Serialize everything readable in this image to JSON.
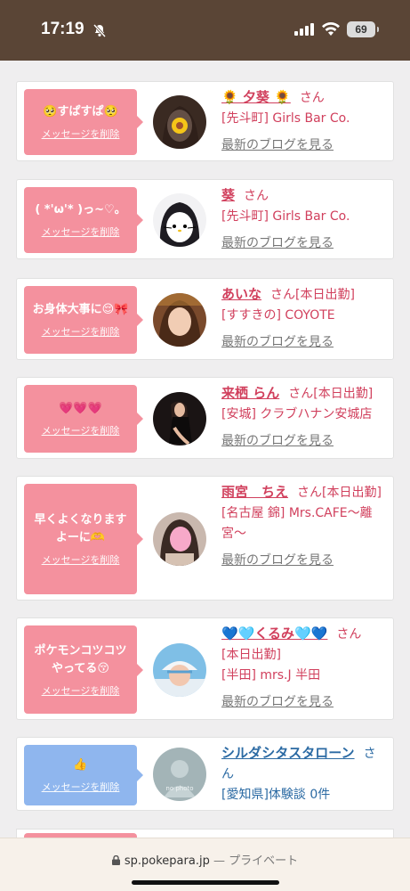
{
  "status": {
    "time": "17:19",
    "battery": "69"
  },
  "cards": [
    {
      "bubble": "🥺すぱすぱ🥺",
      "delete": "メッセージを削除",
      "name": "🌻 夕葵 🌻",
      "san": "さん",
      "shop": "[先斗町] Girls Bar Co.",
      "blog": "最新のブログを見る"
    },
    {
      "bubble": "( *'ω'* )っ~♡。",
      "delete": "メッセージを削除",
      "name": "葵",
      "san": "さん",
      "shop": "[先斗町] Girls Bar Co.",
      "blog": "最新のブログを見る"
    },
    {
      "bubble": "お身体大事に😌🎀",
      "delete": "メッセージを削除",
      "name": "あいな",
      "san": "さん[本日出勤]",
      "shop": "[すすきの] COYOTE",
      "blog": "最新のブログを見る"
    },
    {
      "bubble": "💗💗💗",
      "delete": "メッセージを削除",
      "name": "来栖 らん",
      "san": "さん[本日出勤]",
      "shop": "[安城] クラブハナン安城店",
      "blog": "最新のブログを見る"
    },
    {
      "bubble": "早くよくなりますよーに🫶",
      "delete": "メッセージを削除",
      "name": "雨宮　ちえ",
      "san": "さん[本日出勤]",
      "shop": "[名古屋 錦] Mrs.CAFE〜離宮〜",
      "blog": "最新のブログを見る"
    },
    {
      "bubble": "ポケモンコツコツやってる😚",
      "delete": "メッセージを削除",
      "name": "💙🩵くるみ🩵💙",
      "san": "さん",
      "extra": "[本日出勤]",
      "shop": "[半田] mrs.J 半田",
      "blog": "最新のブログを見る"
    },
    {
      "bubble": "👍",
      "delete": "メッセージを削除",
      "name": "シルダシタスタローン",
      "san": "さん",
      "shop": "[愛知県]体験談 0件",
      "avatar_text": "no photo"
    }
  ],
  "browser": {
    "url": "sp.pokepara.jp",
    "separator": "—",
    "mode": "プライベート"
  }
}
